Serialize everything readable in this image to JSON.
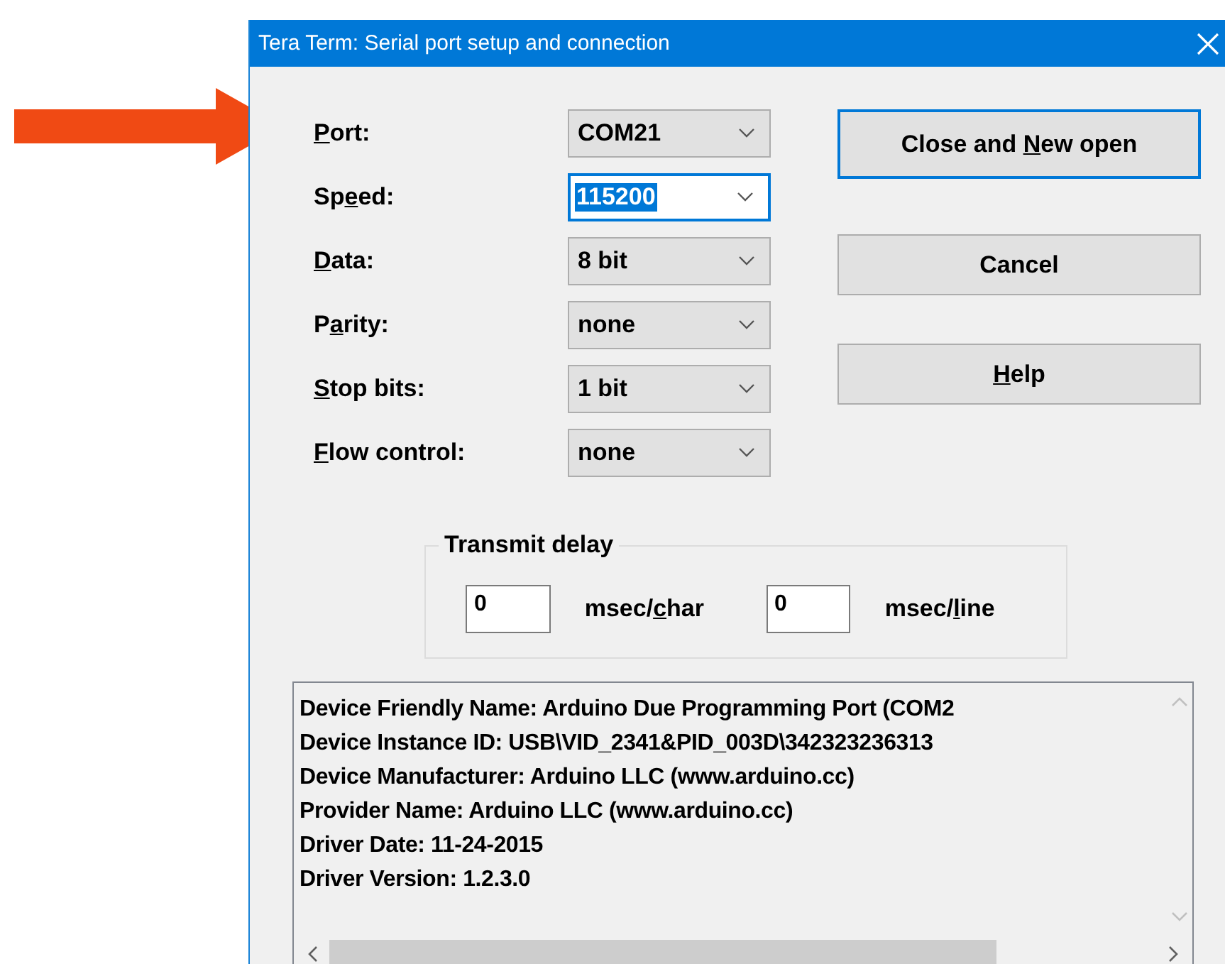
{
  "window": {
    "title": "Tera Term: Serial port setup and connection"
  },
  "settings": [
    {
      "label": [
        {
          "text": "P",
          "underlined": true
        },
        {
          "text": "ort:",
          "underlined": false
        }
      ],
      "value": "COM21",
      "focused": false
    },
    {
      "label": [
        {
          "text": "Sp",
          "underlined": false
        },
        {
          "text": "e",
          "underlined": true
        },
        {
          "text": "ed:",
          "underlined": false
        }
      ],
      "value": "115200",
      "focused": true
    },
    {
      "label": [
        {
          "text": "D",
          "underlined": true
        },
        {
          "text": "ata:",
          "underlined": false
        }
      ],
      "value": "8 bit",
      "focused": false
    },
    {
      "label": [
        {
          "text": "P",
          "underlined": false
        },
        {
          "text": "a",
          "underlined": true
        },
        {
          "text": "rity:",
          "underlined": false
        }
      ],
      "value": "none",
      "focused": false
    },
    {
      "label": [
        {
          "text": "S",
          "underlined": true
        },
        {
          "text": "top bits:",
          "underlined": false
        }
      ],
      "value": "1 bit",
      "focused": false
    },
    {
      "label": [
        {
          "text": "F",
          "underlined": true
        },
        {
          "text": "low control:",
          "underlined": false
        }
      ],
      "value": "none",
      "focused": false
    }
  ],
  "buttons": [
    {
      "label": [
        {
          "text": "Close and ",
          "underlined": false
        },
        {
          "text": "N",
          "underlined": true
        },
        {
          "text": "ew open",
          "underlined": false
        }
      ],
      "default": true
    },
    {
      "label": [
        {
          "text": "Cancel",
          "underlined": false
        }
      ],
      "default": false
    },
    {
      "label": [
        {
          "text": "H",
          "underlined": true
        },
        {
          "text": "elp",
          "underlined": false
        }
      ],
      "default": false
    }
  ],
  "transmit_delay": {
    "title": "Transmit delay",
    "fields": [
      {
        "value": "0",
        "unit": [
          {
            "text": "msec/",
            "underlined": false
          },
          {
            "text": "c",
            "underlined": true
          },
          {
            "text": "har",
            "underlined": false
          }
        ]
      },
      {
        "value": "0",
        "unit": [
          {
            "text": "msec/",
            "underlined": false
          },
          {
            "text": "l",
            "underlined": true
          },
          {
            "text": "ine",
            "underlined": false
          }
        ]
      }
    ]
  },
  "device_info": [
    "Device Friendly Name: Arduino Due Programming Port (COM2",
    "Device Instance ID: USB\\VID_2341&PID_003D\\342323236313",
    "Device Manufacturer: Arduino LLC (www.arduino.cc)",
    "Provider Name: Arduino LLC (www.arduino.cc)",
    "Driver Date: 11-24-2015",
    "Driver Version: 1.2.3.0"
  ]
}
